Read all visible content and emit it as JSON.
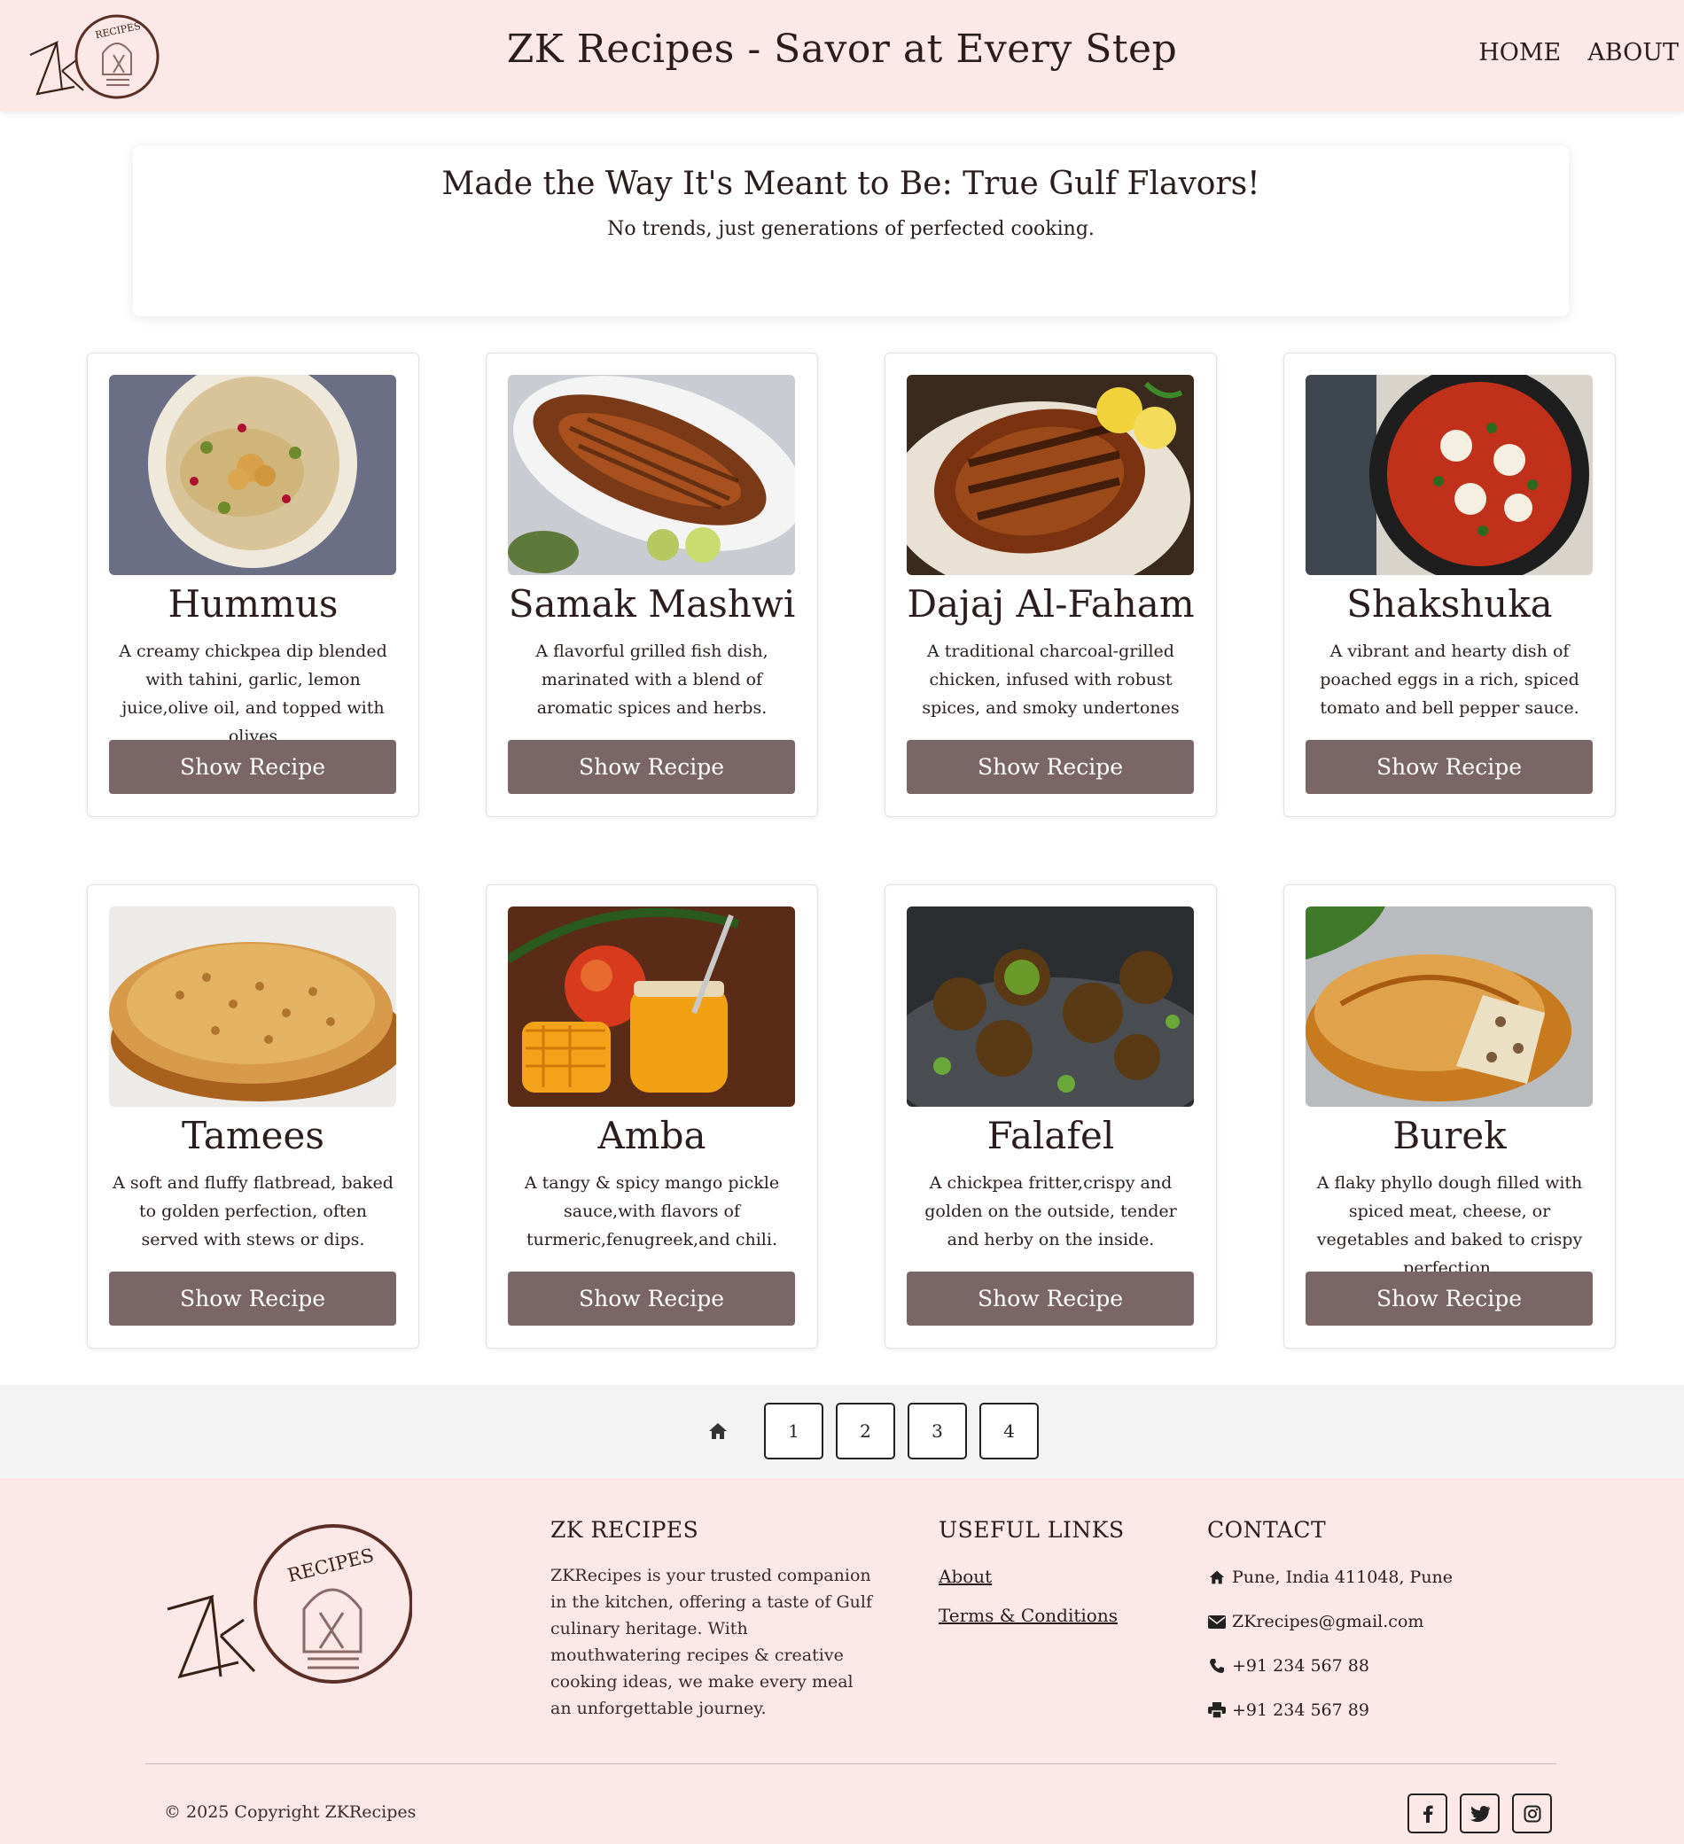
{
  "header": {
    "site_title": "ZK Recipes - Savor at Every Step",
    "nav": [
      {
        "label": "HOME"
      },
      {
        "label": "ABOUT"
      }
    ]
  },
  "banner": {
    "heading": "Made the Way It's Meant to Be: True Gulf Flavors!",
    "subheading": "No trends, just generations of perfected cooking."
  },
  "recipes": [
    {
      "title": "Hummus",
      "description": "A creamy chickpea dip blended with tahini, garlic, lemon juice,olive oil, and topped with olives",
      "button": "Show Recipe",
      "image_icon": "hummus-photo"
    },
    {
      "title": "Samak Mashwi",
      "description": "A flavorful grilled fish dish, marinated with a blend of aromatic spices and herbs.",
      "button": "Show Recipe",
      "image_icon": "grilled-fish-photo"
    },
    {
      "title": "Dajaj Al-Faham",
      "description": "A traditional charcoal-grilled chicken, infused with robust spices, and smoky undertones",
      "button": "Show Recipe",
      "image_icon": "grilled-chicken-photo"
    },
    {
      "title": "Shakshuka",
      "description": "A vibrant and hearty dish of poached eggs in a rich, spiced tomato and bell pepper sauce.",
      "button": "Show Recipe",
      "image_icon": "shakshuka-photo"
    },
    {
      "title": "Tamees",
      "description": "A soft and fluffy flatbread, baked to golden perfection, often served with stews or dips.",
      "button": "Show Recipe",
      "image_icon": "flatbread-photo"
    },
    {
      "title": "Amba",
      "description": "A tangy & spicy mango pickle sauce,with flavors of turmeric,fenugreek,and chili.",
      "button": "Show Recipe",
      "image_icon": "mango-pickle-photo"
    },
    {
      "title": "Falafel",
      "description": "A chickpea fritter,crispy and golden on the outside, tender and herby on the inside.",
      "button": "Show Recipe",
      "image_icon": "falafel-photo"
    },
    {
      "title": "Burek",
      "description": "A flaky phyllo dough filled with spiced meat, cheese, or vegetables and baked to crispy perfection.",
      "button": "Show Recipe",
      "image_icon": "burek-photo"
    }
  ],
  "pagination": {
    "home_icon": "home-icon",
    "pages": [
      "1",
      "2",
      "3",
      "4"
    ]
  },
  "footer": {
    "about_heading": "ZK RECIPES",
    "about_text": "ZKRecipes is your trusted companion in the kitchen, offering a taste of Gulf culinary heritage. With mouthwatering recipes & creative cooking ideas, we make every meal an unforgettable journey.",
    "links_heading": "USEFUL LINKS",
    "links": [
      "About",
      "Terms & Conditions"
    ],
    "contact_heading": "CONTACT",
    "contact": [
      {
        "icon": "home-icon",
        "text": "Pune, India 411048, Pune"
      },
      {
        "icon": "envelope-icon",
        "text": "ZKrecipes@gmail.com"
      },
      {
        "icon": "phone-icon",
        "text": "+91 234 567 88"
      },
      {
        "icon": "print-icon",
        "text": "+91 234 567 89"
      }
    ],
    "copyright": "© 2025 Copyright ZKRecipes",
    "social": [
      "facebook-icon",
      "twitter-icon",
      "instagram-icon"
    ]
  },
  "logo": {
    "text": "RECIPES",
    "initials": "ZK"
  },
  "colors": {
    "header_bg": "#fde8e8",
    "button_bg": "#7a6666",
    "footer_bg": "#fde8e8",
    "pager_bg": "#f3f3f3"
  }
}
